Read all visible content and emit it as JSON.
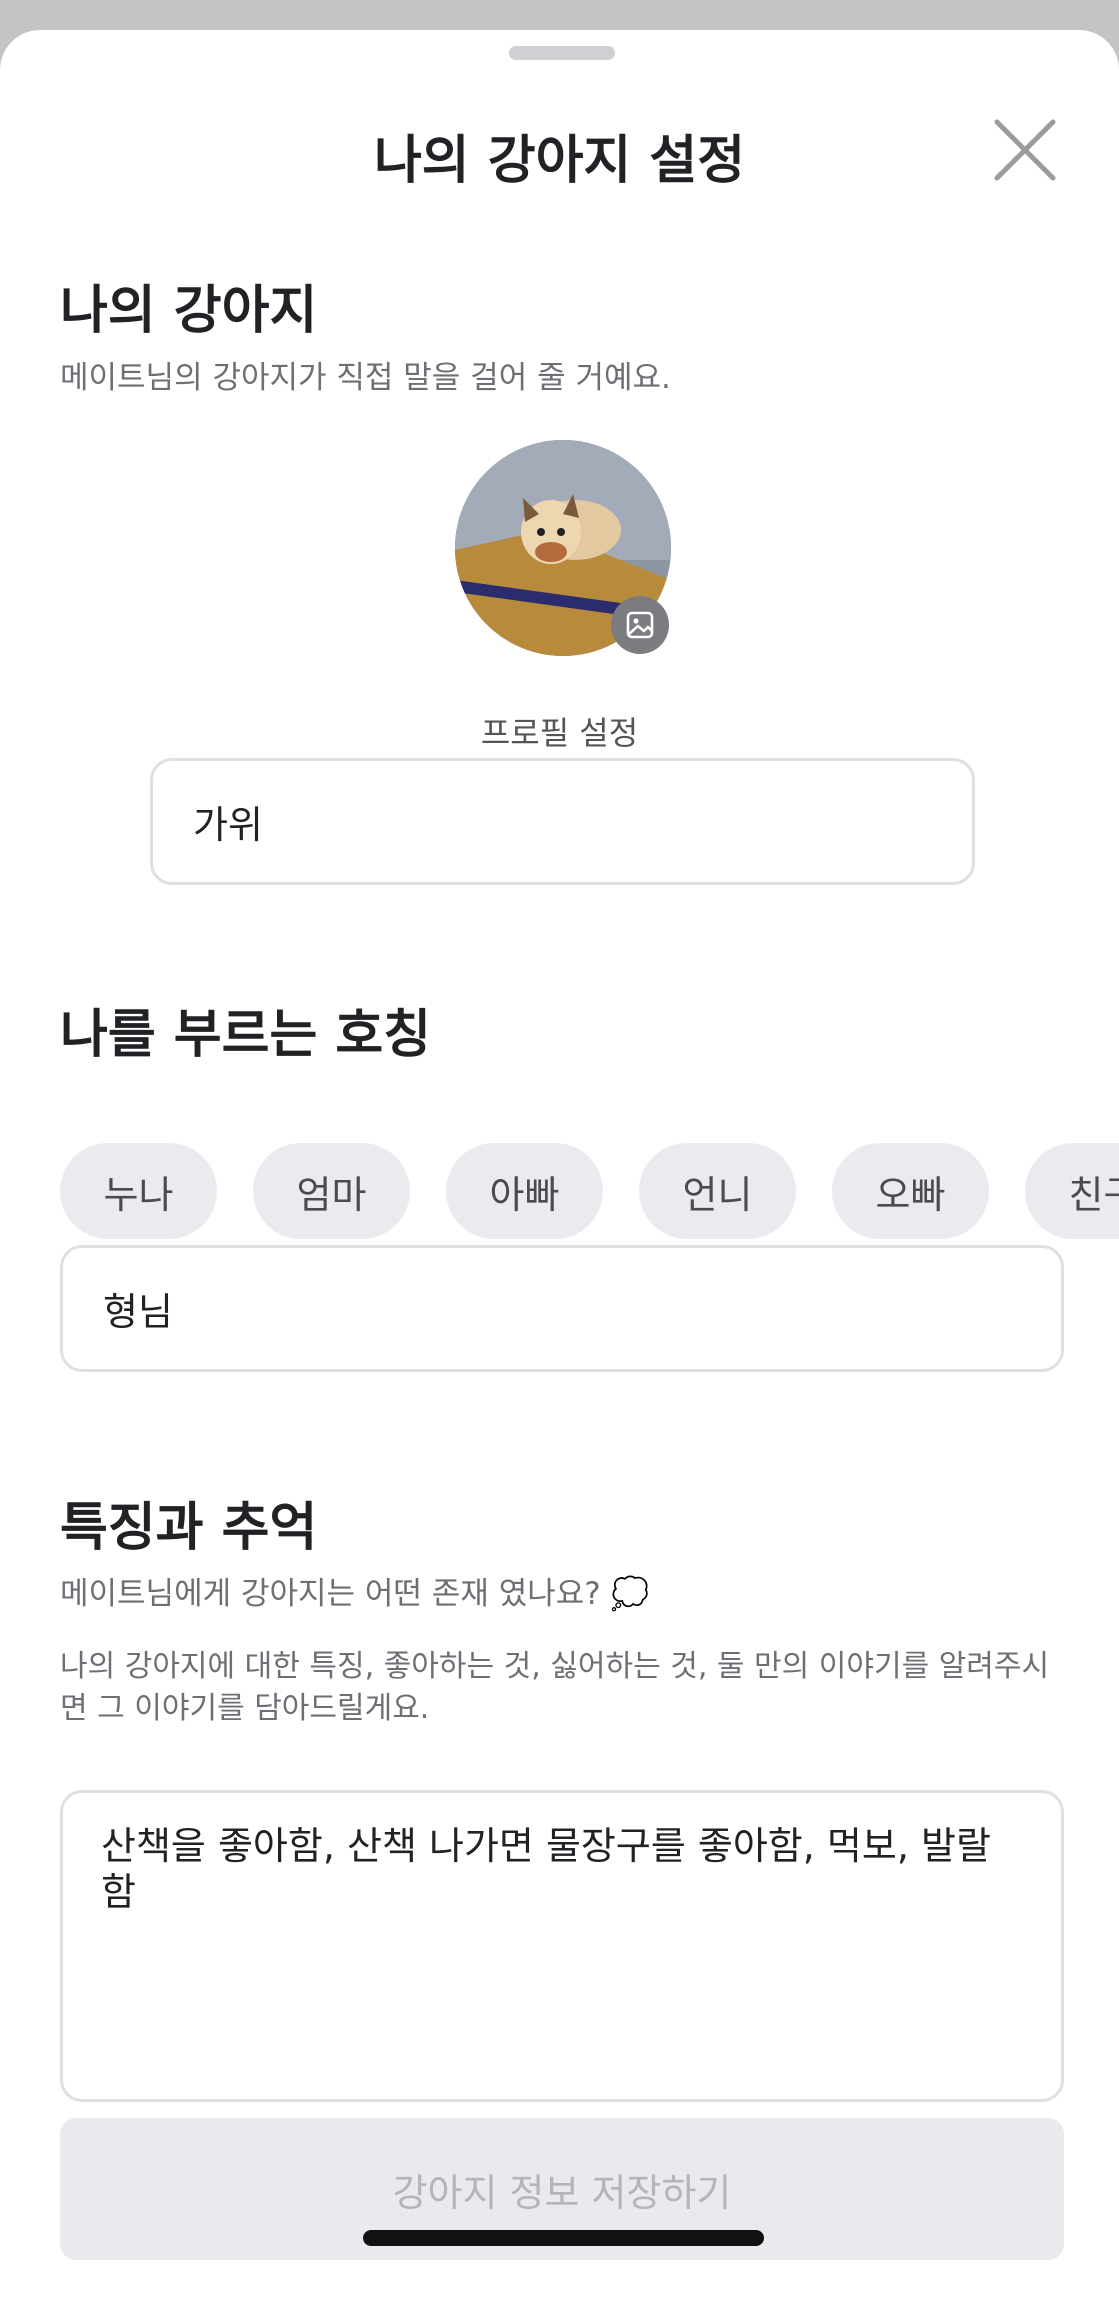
{
  "sheet": {
    "title": "나의 강아지 설정",
    "close_icon": "close-icon"
  },
  "my_dog": {
    "title": "나의 강아지",
    "description": "메이트님의 강아지가 직접 말을 걸어 줄 거예요.",
    "profile_label": "프로필 설정",
    "photo_icon": "image-icon",
    "name_value": "가위"
  },
  "nickname": {
    "title": "나를 부르는 호칭",
    "options": [
      "누나",
      "엄마",
      "아빠",
      "언니",
      "오빠",
      "친구"
    ],
    "custom_value": "형님"
  },
  "traits": {
    "title": "특징과 추억",
    "question": "메이트님에게 강아지는 어떤 존재 였나요? 💭",
    "guide": "나의 강아지에 대한 특징, 좋아하는 것, 싫어하는 것, 둘 만의 이야기를 알려주시면 그 이야기를 담아드릴게요.",
    "value": "산책을 좋아함, 산책 나가면 물장구를 좋아함, 먹보, 발랄함"
  },
  "save_button": {
    "label": "강아지 정보 저장하기"
  }
}
